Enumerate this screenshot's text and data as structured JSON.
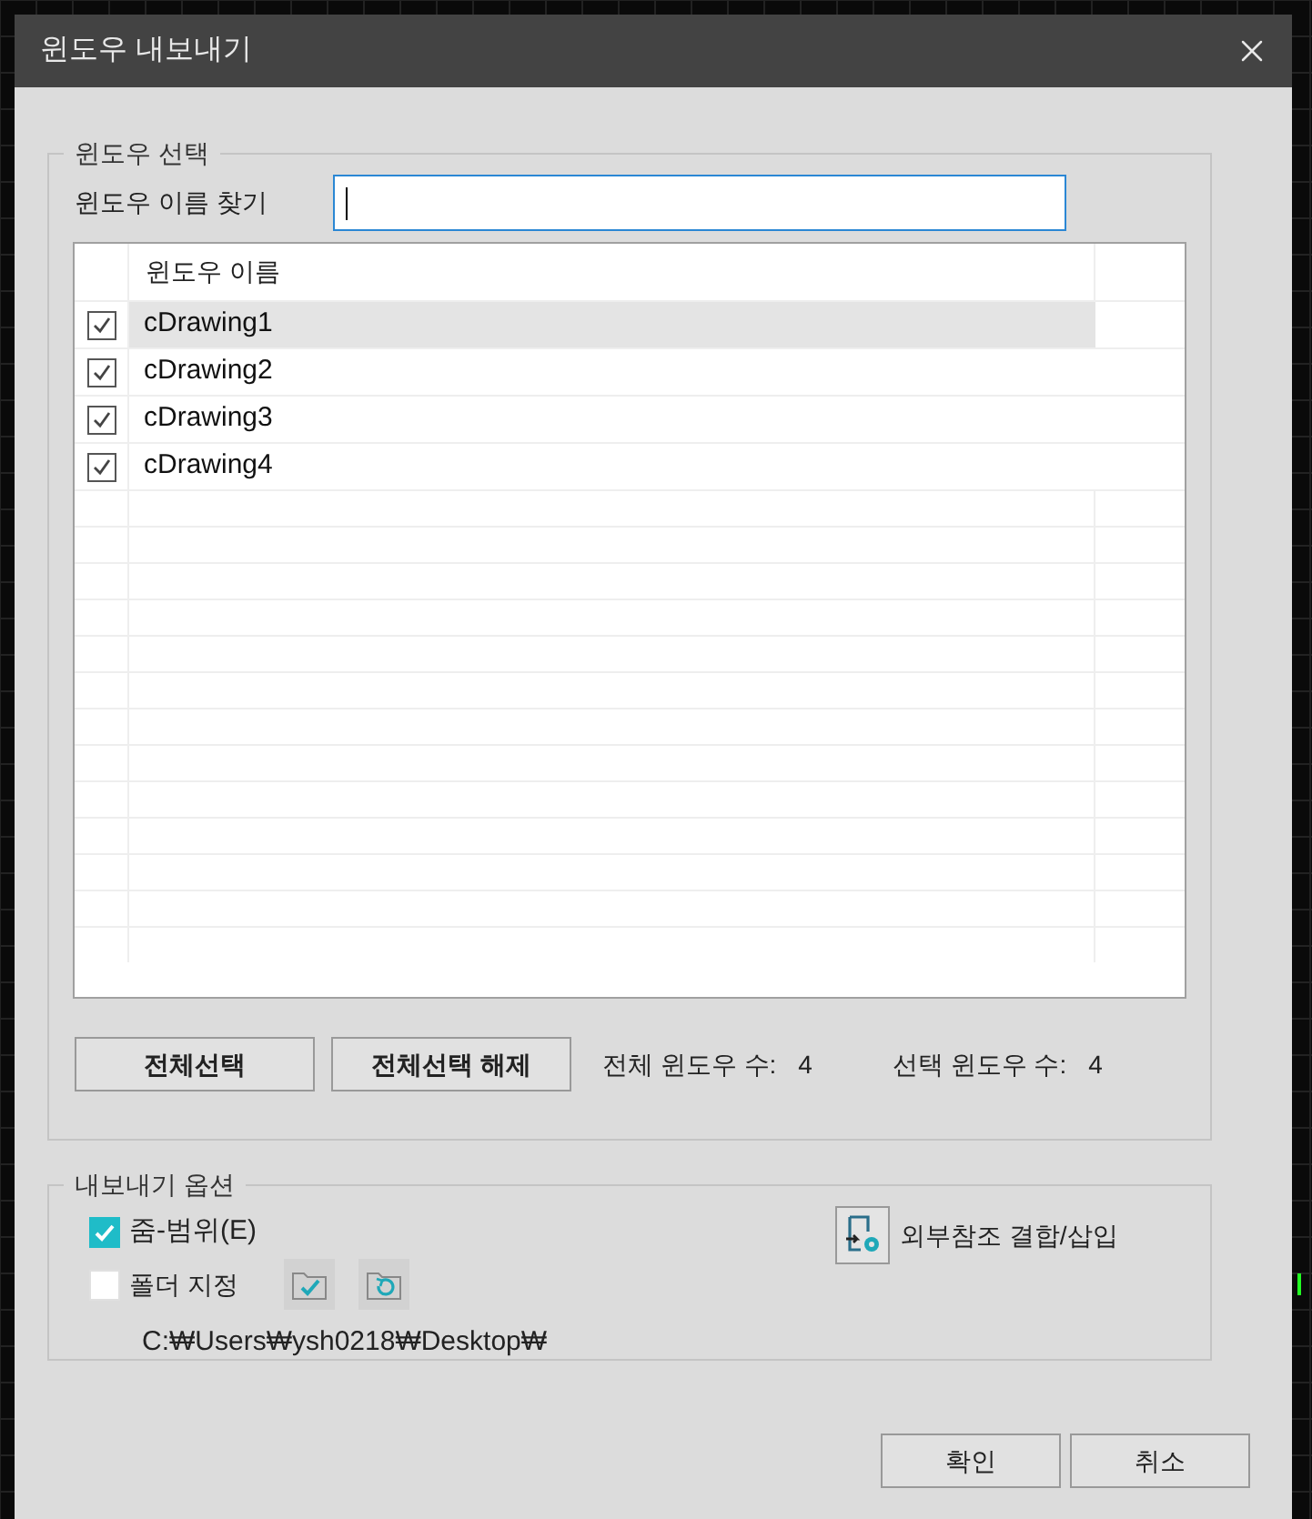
{
  "window": {
    "title": "윈도우 내보내기"
  },
  "window_select": {
    "legend": "윈도우 선택",
    "search_label": "윈도우 이름 찾기",
    "column": "윈도우 이름",
    "rows": [
      {
        "name": "cDrawing1",
        "checked": true,
        "selected": true
      },
      {
        "name": "cDrawing2",
        "checked": true,
        "selected": false
      },
      {
        "name": "cDrawing3",
        "checked": true,
        "selected": false
      },
      {
        "name": "cDrawing4",
        "checked": true,
        "selected": false
      }
    ],
    "buttons": [
      "전체선택",
      "전체선택 해제"
    ],
    "counts": [
      {
        "label": "전체 윈도우 수:",
        "value": "4"
      },
      {
        "label": "선택 윈도우 수:",
        "value": "4"
      }
    ]
  },
  "export_options": {
    "legend": "내보내기 옵션",
    "zoom_extents": {
      "label": "줌-범위(E)",
      "checked": true
    },
    "folder": {
      "label": "폴더 지정",
      "checked": false
    },
    "xref_button": "외부참조 결합/삽입",
    "path": "C:₩Users₩ysh0218₩Desktop₩"
  },
  "footer_buttons": [
    "확인",
    "취소"
  ]
}
